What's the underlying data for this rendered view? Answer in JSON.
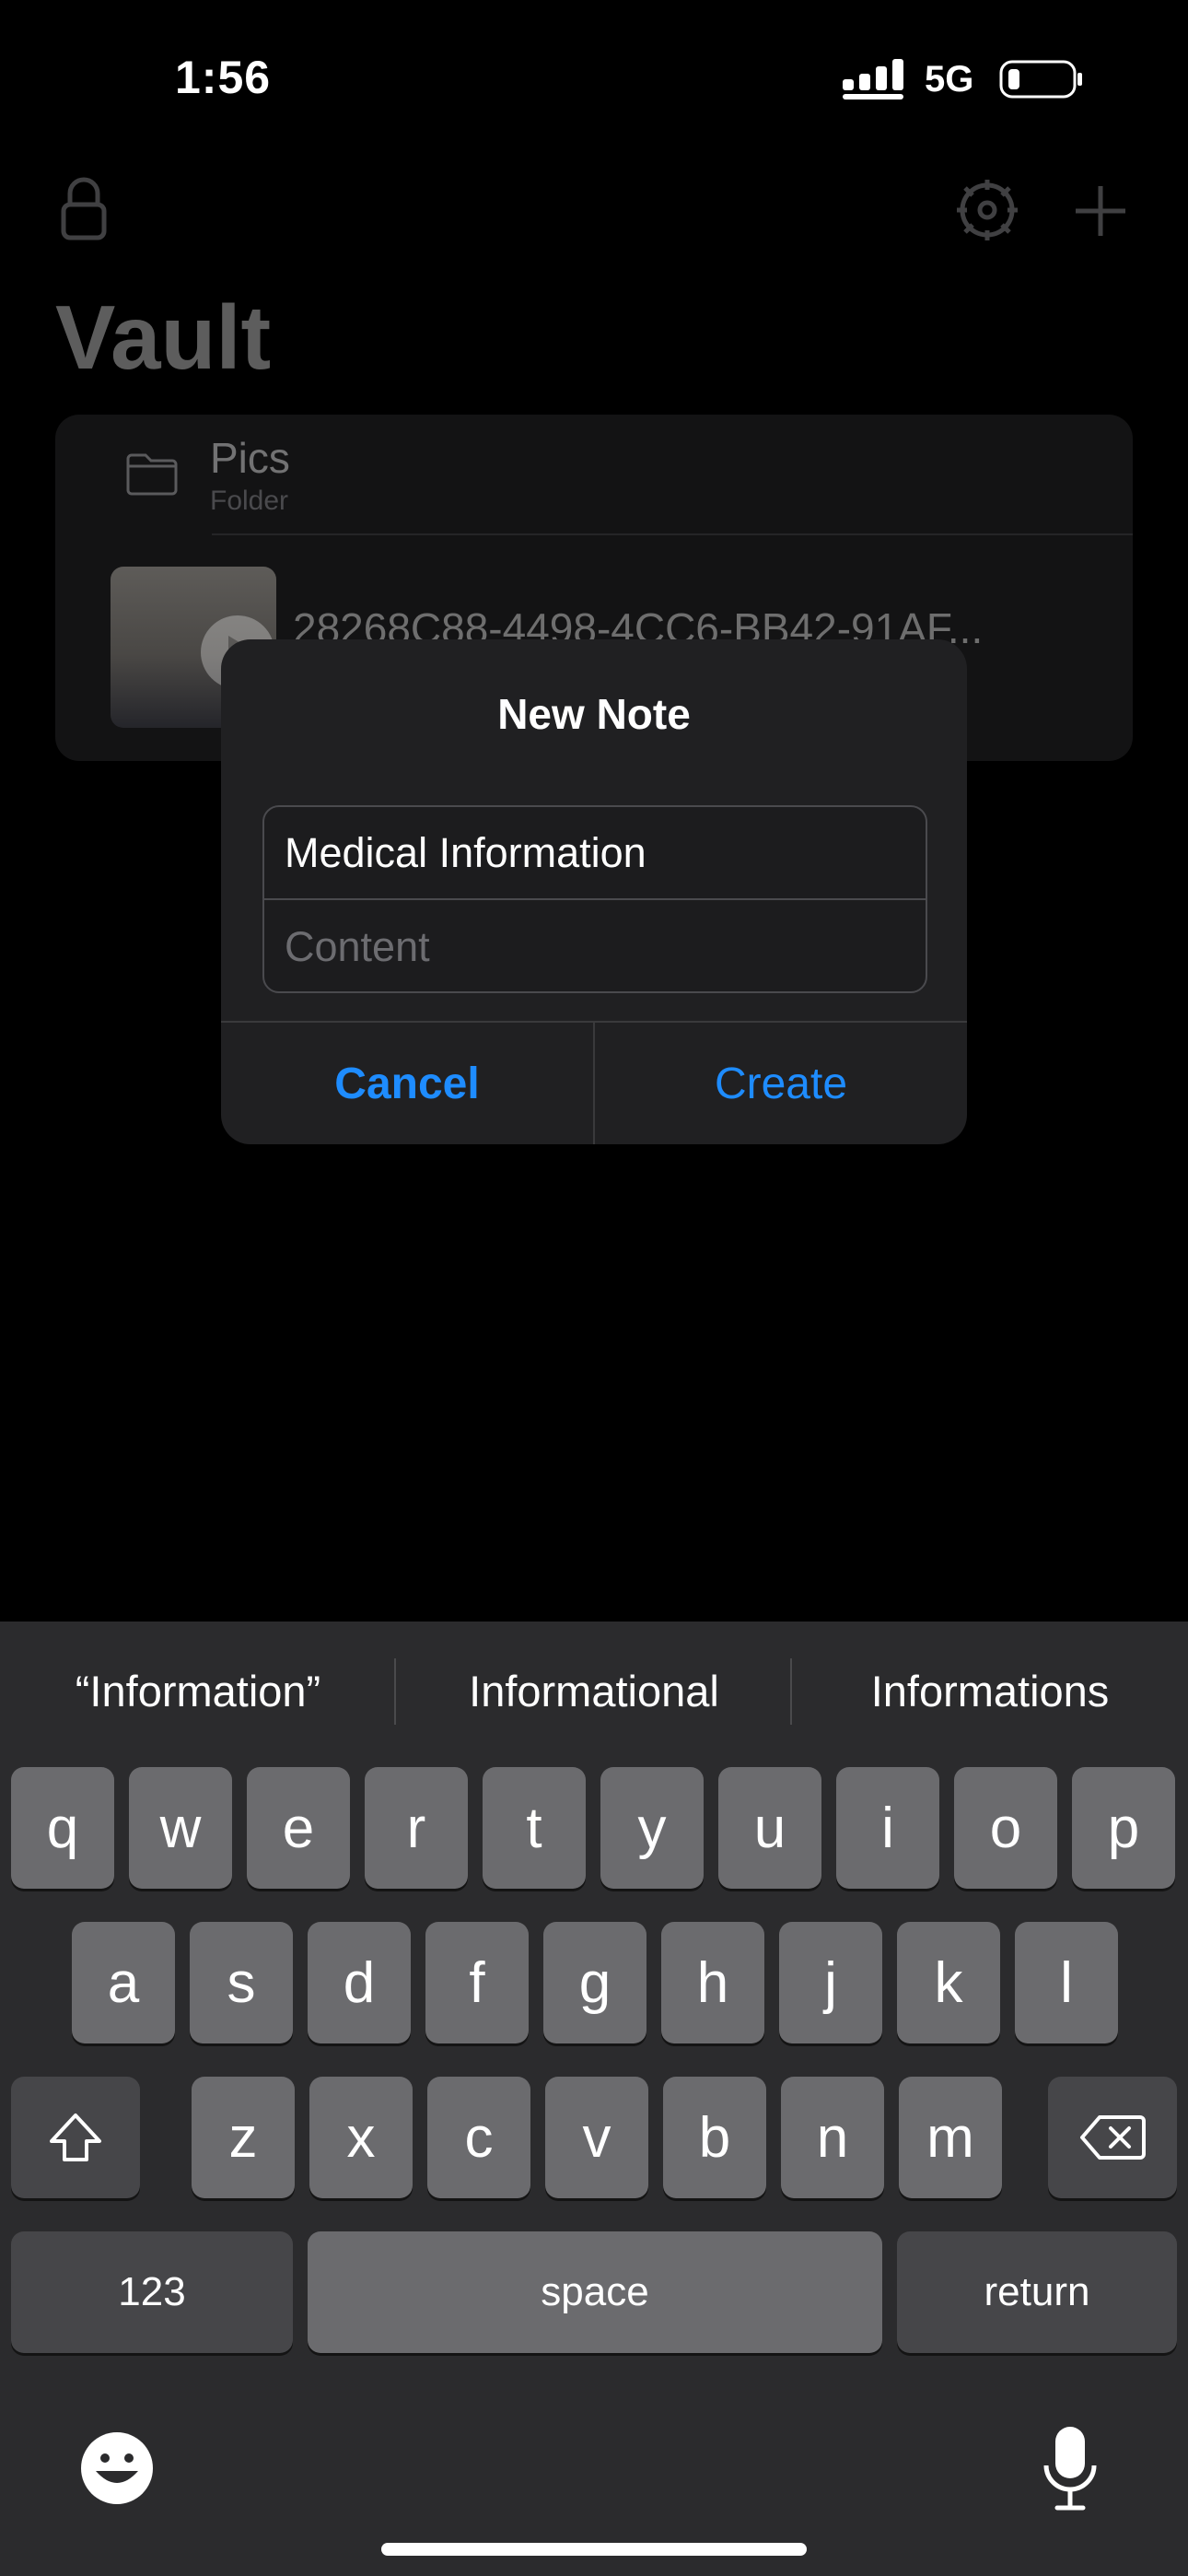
{
  "status_bar": {
    "time": "1:56",
    "network": "5G"
  },
  "app": {
    "title": "Vault",
    "items": [
      {
        "name": "Pics",
        "subtitle": "Folder",
        "icon": "folder-icon"
      },
      {
        "name": "28268C88-4498-4CC6-BB42-91AF...",
        "icon": "video-thumbnail"
      }
    ],
    "toolbar_icons": [
      "lock-icon",
      "settings-icon",
      "add-icon"
    ]
  },
  "dialog": {
    "title": "New Note",
    "title_field_value": "Medical Information",
    "content_placeholder": "Content",
    "cancel_label": "Cancel",
    "create_label": "Create"
  },
  "keyboard": {
    "suggestions": [
      "“Information”",
      "Informational",
      "Informations"
    ],
    "row1": [
      "q",
      "w",
      "e",
      "r",
      "t",
      "y",
      "u",
      "i",
      "o",
      "p"
    ],
    "row2": [
      "a",
      "s",
      "d",
      "f",
      "g",
      "h",
      "j",
      "k",
      "l"
    ],
    "row3": [
      "z",
      "x",
      "c",
      "v",
      "b",
      "n",
      "m"
    ],
    "numbers_label": "123",
    "space_label": "space",
    "return_label": "return"
  },
  "colors": {
    "accent": "#1E8CFF",
    "background": "#000000",
    "dialog": "#202022",
    "key": "#6B6B6E"
  }
}
